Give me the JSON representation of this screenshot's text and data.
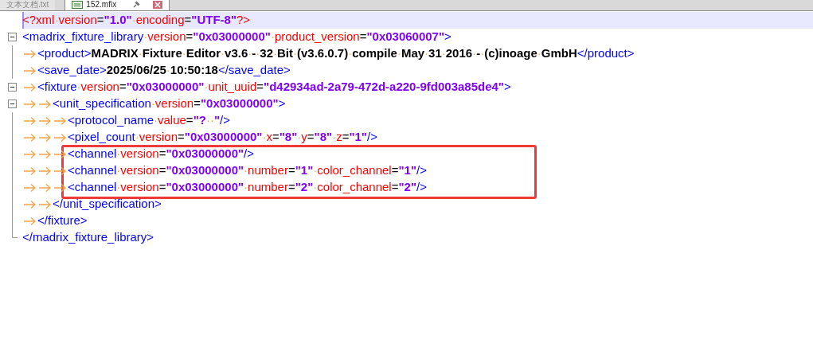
{
  "tabs": [
    {
      "label": "文本文档.txt",
      "selected": false
    },
    {
      "label": "152.mfix",
      "selected": true
    }
  ],
  "lines": [
    {
      "current": true,
      "tokens": [
        {
          "kind": "pi",
          "text": "<?xml·"
        },
        {
          "kind": "attr",
          "text": "version"
        },
        {
          "kind": "eq",
          "text": "="
        },
        {
          "kind": "value",
          "text": "\"1.0\"·"
        },
        {
          "kind": "attr",
          "text": "encoding"
        },
        {
          "kind": "eq",
          "text": "="
        },
        {
          "kind": "value",
          "text": "\"UTF-8\""
        },
        {
          "kind": "pi",
          "text": "?>"
        }
      ]
    },
    {
      "current": false,
      "tokens": [
        {
          "kind": "tag",
          "text": "<madrix_fixture_library·"
        },
        {
          "kind": "attr",
          "text": "version"
        },
        {
          "kind": "eq",
          "text": "="
        },
        {
          "kind": "value",
          "text": "\"0x03000000\"·"
        },
        {
          "kind": "attr",
          "text": "product_version"
        },
        {
          "kind": "eq",
          "text": "="
        },
        {
          "kind": "value",
          "text": "\"0x03060007\""
        },
        {
          "kind": "tag",
          "text": ">"
        }
      ],
      "end_tokens": [
        {
          "kind": "tag",
          "text": "</madrix_fixture_library>"
        }
      ],
      "children": [
        {
          "current": false,
          "tokens": [
            {
              "kind": "tag",
              "text": "<product>"
            },
            {
              "kind": "text",
              "text": "MADRIX·Fixture·Editor·v3.6·-·32·Bit·(v3.6.0.7)·compile·May·31·2016·-·(c)inoage·GmbH"
            },
            {
              "kind": "tag",
              "text": "</product>"
            }
          ]
        },
        {
          "current": false,
          "tokens": [
            {
              "kind": "tag",
              "text": "<save_date>"
            },
            {
              "kind": "text",
              "text": "2025/06/25·10:50:18"
            },
            {
              "kind": "tag",
              "text": "</save_date>"
            }
          ]
        },
        {
          "current": false,
          "tokens": [
            {
              "kind": "tag",
              "text": "<fixture·"
            },
            {
              "kind": "attr",
              "text": "version"
            },
            {
              "kind": "eq",
              "text": "="
            },
            {
              "kind": "value",
              "text": "\"0x03000000\"·"
            },
            {
              "kind": "attr",
              "text": "unit_uuid"
            },
            {
              "kind": "eq",
              "text": "="
            },
            {
              "kind": "value",
              "text": "\"d42934ad-2a79-472d-a220-9fd003a85de4\""
            },
            {
              "kind": "tag",
              "text": ">"
            }
          ],
          "end_tokens": [
            {
              "kind": "tag",
              "text": "</fixture>"
            }
          ],
          "children": [
            {
              "current": false,
              "tokens": [
                {
                  "kind": "tag",
                  "text": "<unit_specification·"
                },
                {
                  "kind": "attr",
                  "text": "version"
                },
                {
                  "kind": "eq",
                  "text": "="
                },
                {
                  "kind": "value",
                  "text": "\"0x03000000\""
                },
                {
                  "kind": "tag",
                  "text": ">"
                }
              ],
              "end_tokens": [
                {
                  "kind": "tag",
                  "text": "</unit_specification>"
                }
              ],
              "children": [
                {
                  "current": false,
                  "tokens": [
                    {
                      "kind": "tag",
                      "text": "<protocol_name·"
                    },
                    {
                      "kind": "attr",
                      "text": "value"
                    },
                    {
                      "kind": "eq",
                      "text": "="
                    },
                    {
                      "kind": "value",
                      "text": "\"?··\""
                    },
                    {
                      "kind": "tag",
                      "text": "/>"
                    }
                  ]
                },
                {
                  "current": false,
                  "tokens": [
                    {
                      "kind": "tag",
                      "text": "<pixel_count·"
                    },
                    {
                      "kind": "attr",
                      "text": "version"
                    },
                    {
                      "kind": "eq",
                      "text": "="
                    },
                    {
                      "kind": "value",
                      "text": "\"0x03000000\"·"
                    },
                    {
                      "kind": "attr",
                      "text": "x"
                    },
                    {
                      "kind": "eq",
                      "text": "="
                    },
                    {
                      "kind": "value",
                      "text": "\"8\"·"
                    },
                    {
                      "kind": "attr",
                      "text": "y"
                    },
                    {
                      "kind": "eq",
                      "text": "="
                    },
                    {
                      "kind": "value",
                      "text": "\"8\"·"
                    },
                    {
                      "kind": "attr",
                      "text": "z"
                    },
                    {
                      "kind": "eq",
                      "text": "="
                    },
                    {
                      "kind": "value",
                      "text": "\"1\""
                    },
                    {
                      "kind": "tag",
                      "text": "/>"
                    }
                  ]
                },
                {
                  "current": false,
                  "annotated": true,
                  "tokens": [
                    {
                      "kind": "tag",
                      "text": "<channel·"
                    },
                    {
                      "kind": "attr",
                      "text": "version"
                    },
                    {
                      "kind": "eq",
                      "text": "="
                    },
                    {
                      "kind": "value",
                      "text": "\"0x03000000\""
                    },
                    {
                      "kind": "tag",
                      "text": "/>"
                    }
                  ]
                },
                {
                  "current": false,
                  "annotated": true,
                  "tokens": [
                    {
                      "kind": "tag",
                      "text": "<channel·"
                    },
                    {
                      "kind": "attr",
                      "text": "version"
                    },
                    {
                      "kind": "eq",
                      "text": "="
                    },
                    {
                      "kind": "value",
                      "text": "\"0x03000000\"·"
                    },
                    {
                      "kind": "attr",
                      "text": "number"
                    },
                    {
                      "kind": "eq",
                      "text": "="
                    },
                    {
                      "kind": "value",
                      "text": "\"1\"·"
                    },
                    {
                      "kind": "attr",
                      "text": "color_channel"
                    },
                    {
                      "kind": "eq",
                      "text": "="
                    },
                    {
                      "kind": "value",
                      "text": "\"1\""
                    },
                    {
                      "kind": "tag",
                      "text": "/>"
                    }
                  ]
                },
                {
                  "current": false,
                  "annotated": true,
                  "tokens": [
                    {
                      "kind": "tag",
                      "text": "<channel·"
                    },
                    {
                      "kind": "attr",
                      "text": "version"
                    },
                    {
                      "kind": "eq",
                      "text": "="
                    },
                    {
                      "kind": "value",
                      "text": "\"0x03000000\"·"
                    },
                    {
                      "kind": "attr",
                      "text": "number"
                    },
                    {
                      "kind": "eq",
                      "text": "="
                    },
                    {
                      "kind": "value",
                      "text": "\"2\"·"
                    },
                    {
                      "kind": "attr",
                      "text": "color_channel"
                    },
                    {
                      "kind": "eq",
                      "text": "="
                    },
                    {
                      "kind": "value",
                      "text": "\"2\""
                    },
                    {
                      "kind": "tag",
                      "text": "/>"
                    }
                  ]
                }
              ]
            }
          ]
        }
      ]
    }
  ]
}
